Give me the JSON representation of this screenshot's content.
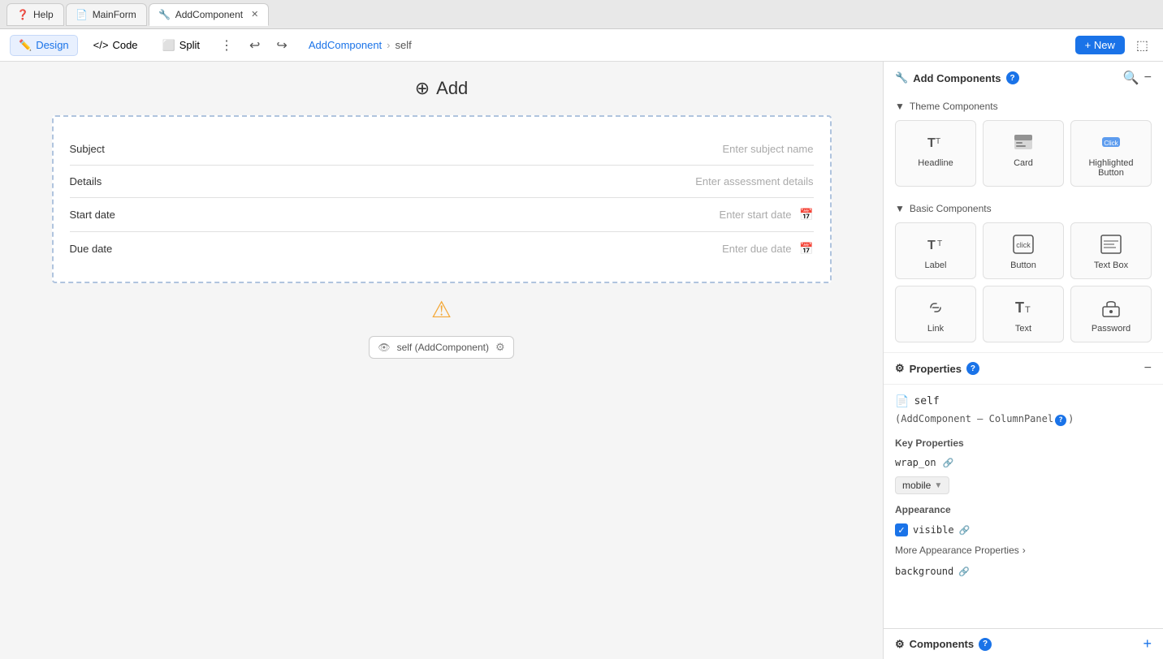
{
  "tabs": [
    {
      "id": "help",
      "label": "Help",
      "icon": "❓",
      "active": false,
      "closable": false
    },
    {
      "id": "mainform",
      "label": "MainForm",
      "icon": "📄",
      "active": false,
      "closable": false
    },
    {
      "id": "addcomponent",
      "label": "AddComponent",
      "icon": "🔧",
      "active": true,
      "closable": true
    }
  ],
  "toolbar": {
    "design_label": "Design",
    "code_label": "Code",
    "split_label": "Split",
    "breadcrumb_component": "AddComponent",
    "breadcrumb_sep": "›",
    "breadcrumb_self": "self",
    "new_label": "+ New"
  },
  "canvas": {
    "title": "Add",
    "title_icon": "⊕",
    "form_rows": [
      {
        "label": "Subject",
        "placeholder": "Enter subject name",
        "has_date_icon": false
      },
      {
        "label": "Details",
        "placeholder": "Enter assessment details",
        "has_date_icon": false
      },
      {
        "label": "Start date",
        "placeholder": "Enter start date",
        "has_date_icon": true
      },
      {
        "label": "Due date",
        "placeholder": "Enter due date",
        "has_date_icon": true
      }
    ],
    "warning_icon": "⚠",
    "component_tag_label": "self (AddComponent)",
    "component_tag_icon": "👁"
  },
  "add_components": {
    "title": "Add Components",
    "help_icon": "?",
    "sections": [
      {
        "id": "theme",
        "label": "Theme Components",
        "expanded": true,
        "items": [
          {
            "id": "headline",
            "label": "Headline",
            "icon_type": "headline"
          },
          {
            "id": "card",
            "label": "Card",
            "icon_type": "card"
          },
          {
            "id": "highlighted-button",
            "label": "Highlighted Button",
            "icon_type": "highlighted-button"
          }
        ]
      },
      {
        "id": "basic",
        "label": "Basic Components",
        "expanded": true,
        "items": [
          {
            "id": "label",
            "label": "Label",
            "icon_type": "label"
          },
          {
            "id": "button",
            "label": "Button",
            "icon_type": "button"
          },
          {
            "id": "text-box",
            "label": "Text Box",
            "icon_type": "text-box"
          },
          {
            "id": "link",
            "label": "Link",
            "icon_type": "link"
          },
          {
            "id": "text",
            "label": "Text",
            "icon_type": "text"
          },
          {
            "id": "password",
            "label": "Password",
            "icon_type": "password"
          }
        ]
      }
    ]
  },
  "properties": {
    "title": "Properties",
    "help_icon": "?",
    "self_label": "self",
    "self_icon": "📄",
    "type_label": "(AddComponent – ColumnPanel",
    "type_suffix": ")",
    "key_properties_title": "Key Properties",
    "wrap_on_label": "wrap_on",
    "wrap_on_value": "mobile",
    "appearance_title": "Appearance",
    "visible_label": "visible",
    "more_props_label": "More Appearance Properties",
    "background_label": "background"
  },
  "components_bottom": {
    "title": "Components",
    "help_icon": "?",
    "add_icon": "+"
  }
}
